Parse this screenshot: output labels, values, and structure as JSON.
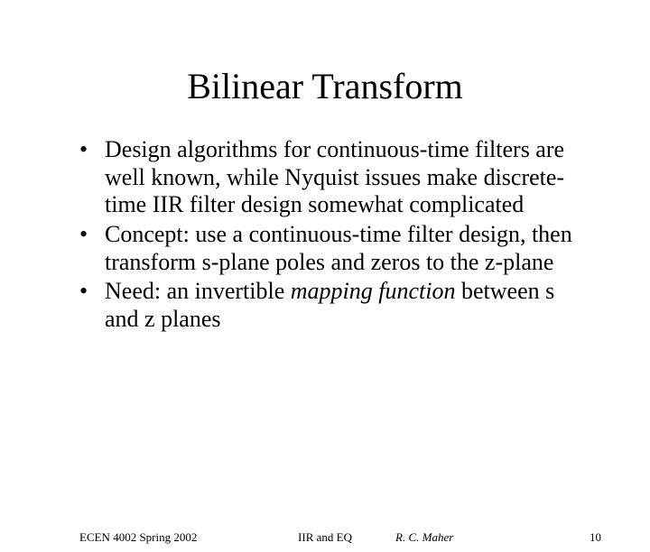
{
  "title": "Bilinear Transform",
  "bullets": {
    "b1": "Design algorithms for continuous-time filters are well known, while Nyquist issues make discrete-time IIR filter design somewhat complicated",
    "b2": "Concept:  use a continuous-time filter design, then transform s-plane poles and zeros to the z-plane",
    "b3_a": "Need:  an invertible ",
    "b3_i": "mapping function",
    "b3_b": " between s and z planes"
  },
  "footer": {
    "course": "ECEN 4002 Spring 2002",
    "topic": "IIR and EQ",
    "author": "R. C. Maher",
    "page": "10"
  }
}
